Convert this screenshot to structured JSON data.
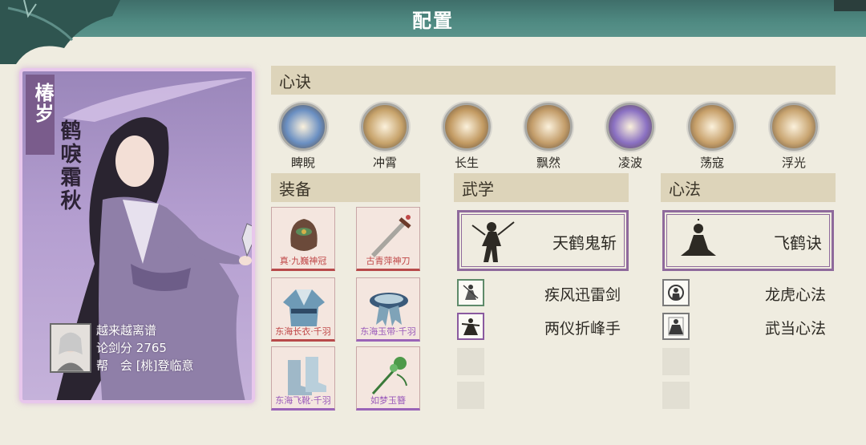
{
  "header": {
    "title": "配置"
  },
  "character": {
    "server": "椿岁",
    "name": "鹤唳霜秋",
    "info": {
      "line1": "越来越离谱",
      "score_label": "论剑分",
      "score": "2765",
      "guild_label": "帮　会",
      "guild": "[桃]登临意"
    },
    "card_color": "#b49ed0"
  },
  "sections": {
    "heart_skills": "心诀",
    "equipment": "装备",
    "martial": "武学",
    "mind": "心法"
  },
  "heart_skills": [
    {
      "label": "睥睨",
      "icon": "blue-dragon-icon",
      "color": "#6a8fc2"
    },
    {
      "label": "冲霄",
      "icon": "golden-swirl-icon",
      "color": "#c7a36b"
    },
    {
      "label": "长生",
      "icon": "golden-lotus-icon",
      "color": "#c29a62"
    },
    {
      "label": "飘然",
      "icon": "golden-feather-icon",
      "color": "#c39d6a"
    },
    {
      "label": "凌波",
      "icon": "purple-wave-icon",
      "color": "#8a70c2"
    },
    {
      "label": "荡寇",
      "icon": "golden-sun-icon",
      "color": "#c7a06a"
    },
    {
      "label": "浮光",
      "icon": "golden-light-icon",
      "color": "#c8a470"
    }
  ],
  "equipment": [
    {
      "name": "真·九巍神冠",
      "icon": "headpiece-icon",
      "rarity": "red"
    },
    {
      "name": "古青萍神刀",
      "icon": "sword-icon",
      "rarity": "red"
    },
    {
      "name": "东海长衣·千羽",
      "icon": "robe-icon",
      "rarity": "red"
    },
    {
      "name": "东海玉带·千羽",
      "icon": "belt-icon",
      "rarity": "purple"
    },
    {
      "name": "东海飞靴·千羽",
      "icon": "boots-icon",
      "rarity": "purple"
    },
    {
      "name": "如梦玉簪",
      "icon": "hairpin-icon",
      "rarity": "purple"
    }
  ],
  "martial": {
    "main": {
      "name": "天鹤鬼斩",
      "icon": "swordsman-icon"
    },
    "subs": [
      {
        "name": "疾风迅雷剑",
        "icon": "sword-stance-icon",
        "frame": "green"
      },
      {
        "name": "两仪折峰手",
        "icon": "palm-stance-icon",
        "frame": "purple"
      }
    ]
  },
  "mind": {
    "main": {
      "name": "飞鹤诀",
      "icon": "meditation-icon"
    },
    "subs": [
      {
        "name": "龙虎心法",
        "icon": "dragon-tiger-icon",
        "frame": "gray"
      },
      {
        "name": "武当心法",
        "icon": "wudang-icon",
        "frame": "gray"
      }
    ]
  }
}
